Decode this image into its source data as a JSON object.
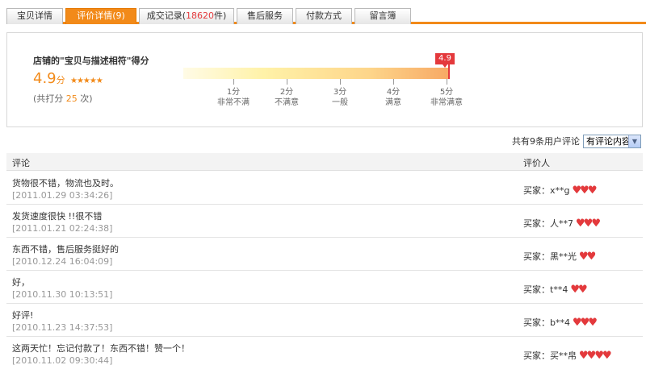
{
  "tabs": [
    {
      "label": "宝贝详情",
      "count": "",
      "suffix": "",
      "active": false
    },
    {
      "label": "评价详情(",
      "count": "9",
      "suffix": ")",
      "active": true
    },
    {
      "label": "成交记录(",
      "count": "18620",
      "suffix": "件)",
      "active": false
    },
    {
      "label": "售后服务",
      "count": "",
      "suffix": "",
      "active": false
    },
    {
      "label": "付款方式",
      "count": "",
      "suffix": "",
      "active": false
    },
    {
      "label": "留言簿",
      "count": "",
      "suffix": "",
      "active": false
    }
  ],
  "rating": {
    "title": "店铺的\"宝贝与描述相符\"得分",
    "score": "4.9",
    "unit": "分",
    "stars": "★★★★★",
    "total_prefix": "(共打分",
    "total_count": "25",
    "total_suffix": "次)",
    "badge": "4.9",
    "scale": [
      {
        "score": "1分",
        "label": "非常不满"
      },
      {
        "score": "2分",
        "label": "不满意"
      },
      {
        "score": "3分",
        "label": "一般"
      },
      {
        "score": "4分",
        "label": "满意"
      },
      {
        "score": "5分",
        "label": "非常满意"
      }
    ]
  },
  "filter": {
    "text": "共有9条用户评论",
    "selected": "有评论内容"
  },
  "table": {
    "col_comment": "评论",
    "col_reviewer": "评价人",
    "rows": [
      {
        "comment": "货物很不错，物流也及时。",
        "date": "[2011.01.29 03:34:26]",
        "buyer": "买家：x**g",
        "hearts": 3
      },
      {
        "comment": "发货速度很快 !!很不错",
        "date": "[2011.01.21 02:24:38]",
        "buyer": "买家：人**7",
        "hearts": 3
      },
      {
        "comment": "东西不错，售后服务挺好的",
        "date": "[2010.12.24 16:04:09]",
        "buyer": "买家：黑**光",
        "hearts": 2
      },
      {
        "comment": "好，",
        "date": "[2010.11.30 10:13:51]",
        "buyer": "买家：t**4",
        "hearts": 2
      },
      {
        "comment": "好评!",
        "date": "[2010.11.23 14:37:53]",
        "buyer": "买家：b**4",
        "hearts": 3
      },
      {
        "comment": "这两天忙！忘记付款了！东西不错！赞一个！",
        "date": "[2010.11.02 09:30:44]",
        "buyer": "买家：买**帛",
        "hearts": 4
      }
    ]
  },
  "colors": {
    "accent": "#f28a19",
    "heart": "#e4393c"
  },
  "icons": {
    "reviewer_rank": "heart-icon",
    "dropdown": "chevron-down-icon"
  }
}
